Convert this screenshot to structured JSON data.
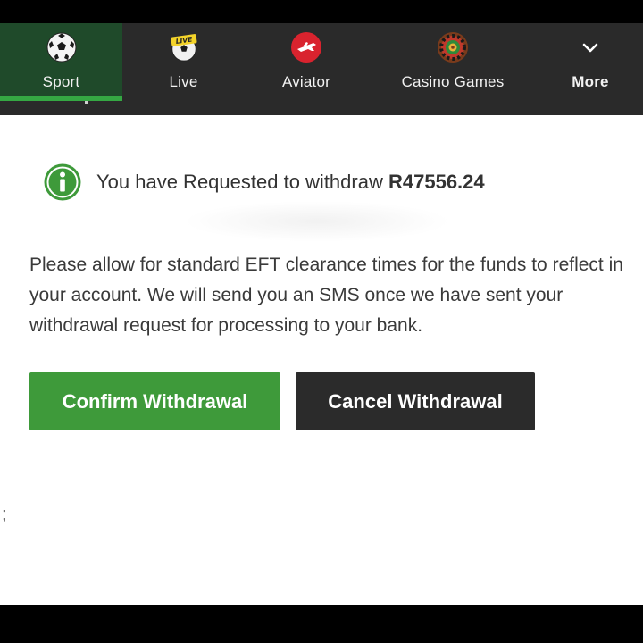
{
  "nav": {
    "items": [
      {
        "label": "Sport",
        "icon": "soccer-ball-icon",
        "active": true
      },
      {
        "label": "Live",
        "icon": "live-ball-icon",
        "active": false
      },
      {
        "label": "Aviator",
        "icon": "aviator-plane-icon",
        "active": false
      },
      {
        "label": "Casino Games",
        "icon": "roulette-wheel-icon",
        "active": false
      },
      {
        "label": "More",
        "icon": "chevron-down-icon",
        "active": false
      }
    ],
    "live_badge": "LIVE"
  },
  "notice": {
    "prefix": "You have Requested to withdraw",
    "amount": "R47556.24",
    "icon": "info-icon"
  },
  "message": "Please allow for standard EFT clearance times for the funds to reflect in your account. We will send you an SMS once we have sent your withdrawal request for processing to your bank.",
  "buttons": {
    "confirm": "Confirm Withdrawal",
    "cancel": "Cancel Withdrawal"
  },
  "stray_char": ";",
  "colors": {
    "nav_bg": "#2a2a2a",
    "active_bg": "#1f4a2a",
    "accent_green": "#35a843",
    "confirm_bg": "#3e9a3a",
    "cancel_bg": "#2b2b2b",
    "aviator_red": "#d9232e"
  }
}
